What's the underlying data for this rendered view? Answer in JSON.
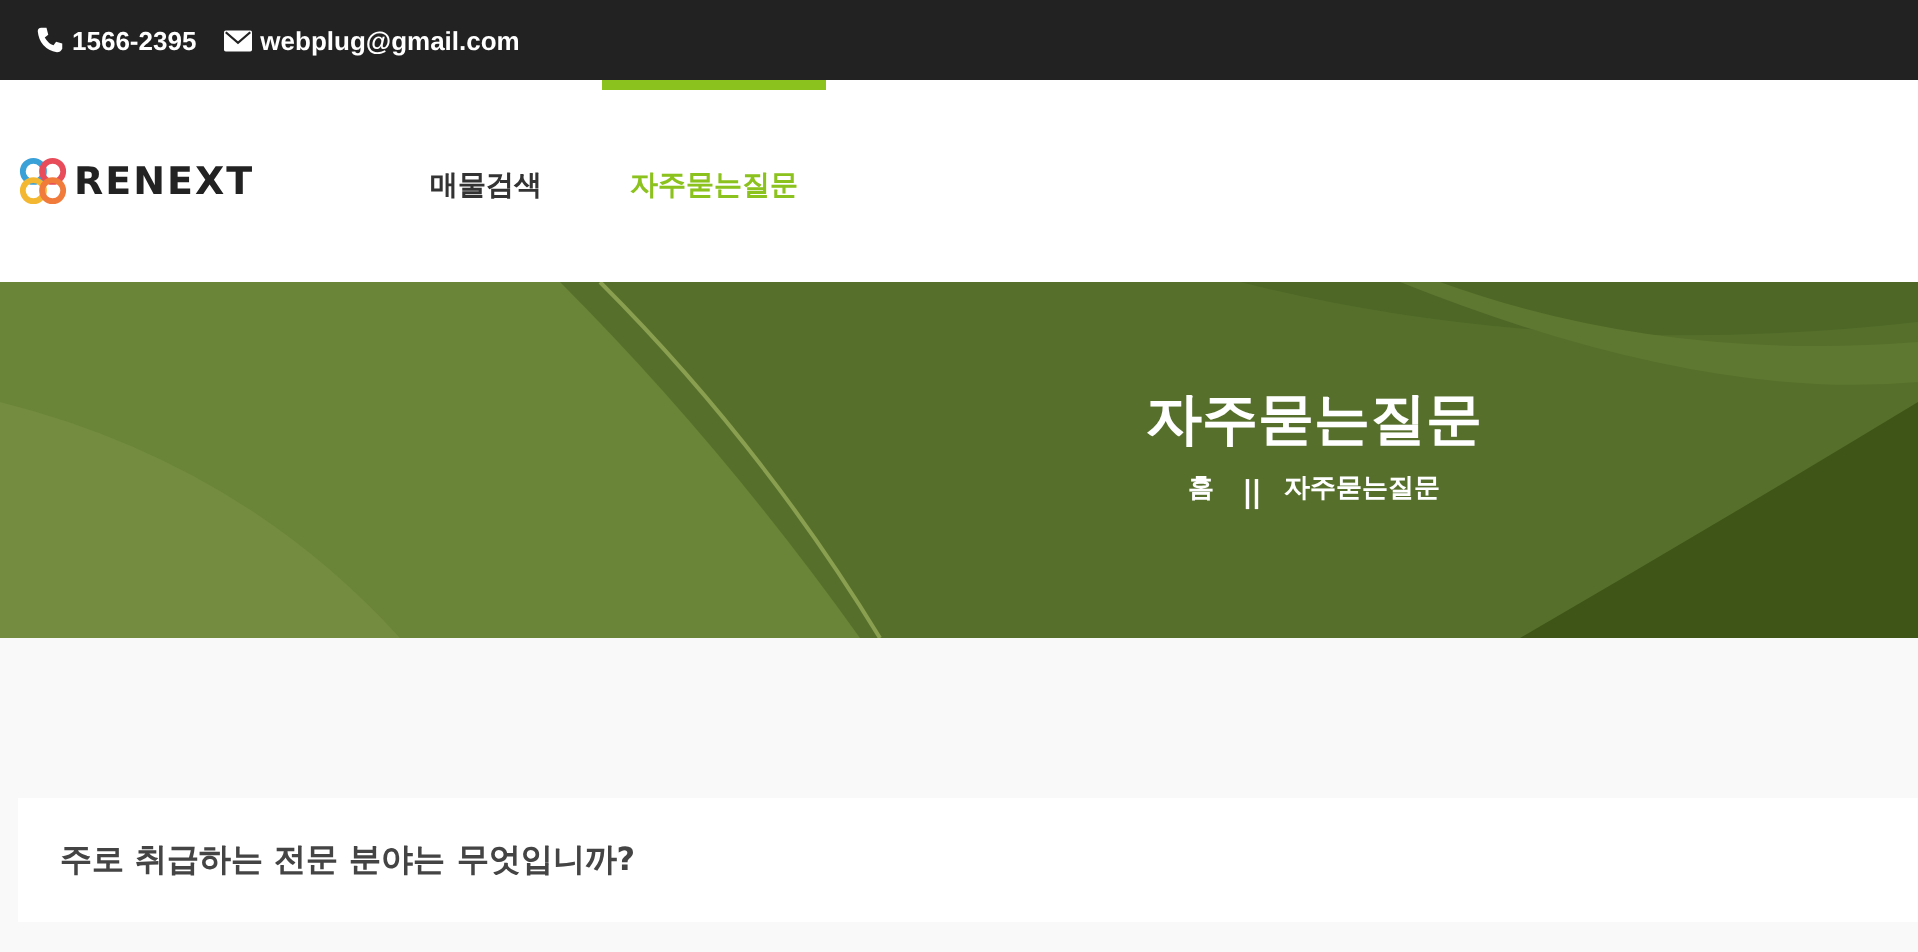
{
  "top_bar": {
    "phone": "1566-2395",
    "email": "webplug@gmail.com"
  },
  "header": {
    "logo": "RENEXT",
    "nav": [
      {
        "label": "매물검색",
        "selected": false
      },
      {
        "label": "자주묻는질문",
        "selected": true
      }
    ]
  },
  "hero": {
    "title": "자주묻는질문",
    "breadcrumb": [
      {
        "label": "홈"
      },
      {
        "label": "||",
        "kind": "separator"
      },
      {
        "label": "자주묻는질문"
      }
    ]
  },
  "faq": [
    {
      "question": "주로 취급하는 전문 분야는 무엇입니까?"
    }
  ]
}
